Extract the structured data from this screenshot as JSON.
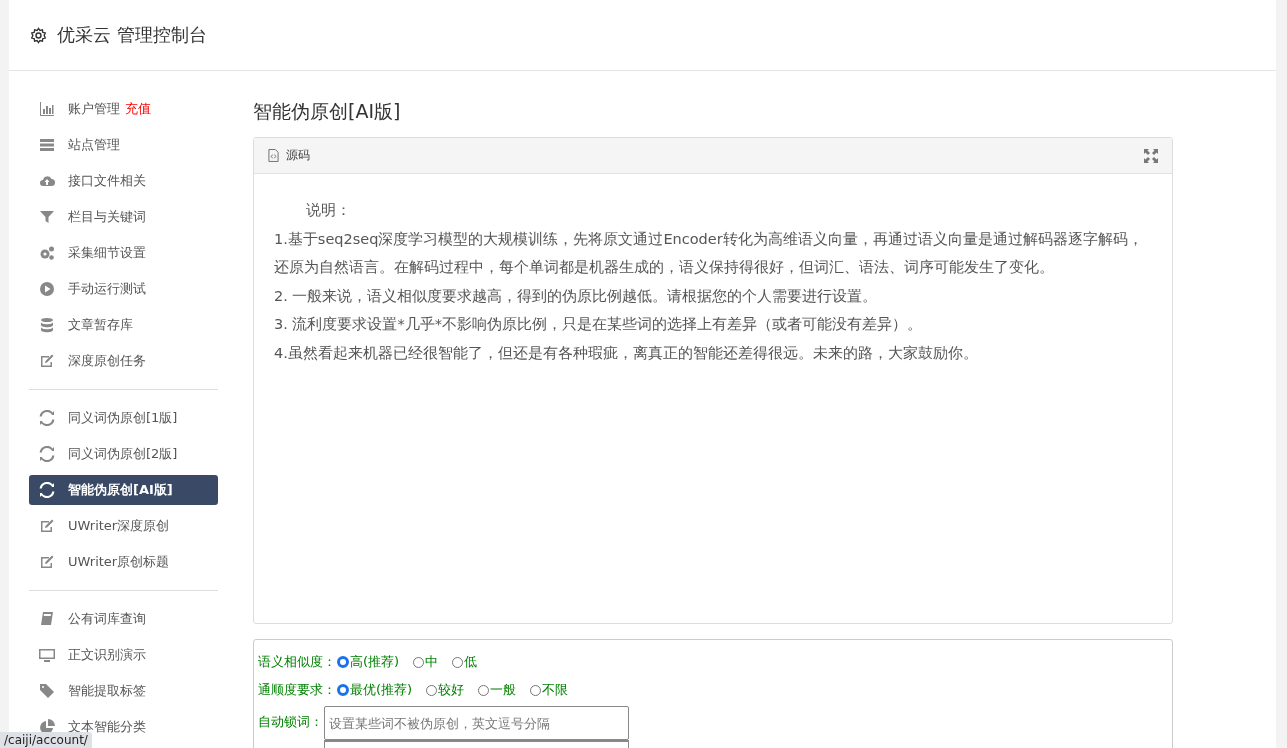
{
  "header": {
    "title": "优采云 管理控制台"
  },
  "sidebar": {
    "groups": [
      {
        "items": [
          {
            "label": "账户管理",
            "badge": "充值",
            "selected": false
          },
          {
            "label": "站点管理",
            "selected": false
          },
          {
            "label": "接口文件相关",
            "selected": false
          },
          {
            "label": "栏目与关键词",
            "selected": false
          },
          {
            "label": "采集细节设置",
            "selected": false
          },
          {
            "label": "手动运行测试",
            "selected": false
          },
          {
            "label": "文章暂存库",
            "selected": false
          },
          {
            "label": "深度原创任务",
            "selected": false
          }
        ]
      },
      {
        "items": [
          {
            "label": "同义词伪原创[1版]",
            "selected": false
          },
          {
            "label": "同义词伪原创[2版]",
            "selected": false
          },
          {
            "label": "智能伪原创[AI版]",
            "selected": true
          },
          {
            "label": "UWriter深度原创",
            "selected": false
          },
          {
            "label": "UWriter原创标题",
            "selected": false
          }
        ]
      },
      {
        "items": [
          {
            "label": "公有词库查询",
            "selected": false
          },
          {
            "label": "正文识别演示",
            "selected": false
          },
          {
            "label": "智能提取标签",
            "selected": false
          },
          {
            "label": "文本智能分类",
            "selected": false
          }
        ]
      }
    ]
  },
  "main": {
    "heading": "智能伪原创[AI版]",
    "source_panel": {
      "tab": "源码",
      "paragraphs": [
        {
          "kind": "title",
          "text": "说明："
        },
        {
          "kind": "body",
          "text": "1.基于seq2seq深度学习模型的大规模训练，先将原文通过Encoder转化为高维语义向量，再通过语义向量是通过解码器逐字解码，还原为自然语言。在解码过程中，每个单词都是机器生成的，语义保持得很好，但词汇、语法、词序可能发生了变化。"
        },
        {
          "kind": "body",
          "text": "2. 一般来说，语义相似度要求越高，得到的伪原比例越低。请根据您的个人需要进行设置。"
        },
        {
          "kind": "body",
          "text": "3. 流利度要求设置*几乎*不影响伪原比例，只是在某些词的选择上有差异（或者可能没有差异）。"
        },
        {
          "kind": "body",
          "text": "4.虽然看起来机器已经很智能了，但还是有各种瑕疵，离真正的智能还差得很远。未来的路，大家鼓励你。"
        }
      ]
    },
    "form": {
      "radio_rows": [
        {
          "label": "语义相似度：",
          "options": [
            {
              "label": "高(推荐)",
              "selected": true
            },
            {
              "label": "中",
              "selected": false
            },
            {
              "label": "低",
              "selected": false
            }
          ]
        },
        {
          "label": "通顺度要求：",
          "options": [
            {
              "label": "最优(推荐)",
              "selected": true
            },
            {
              "label": "较好",
              "selected": false
            },
            {
              "label": "一般",
              "selected": false
            },
            {
              "label": "不限",
              "selected": false
            }
          ]
        }
      ],
      "lock_words": {
        "label": "自动锁词：",
        "placeholder": "设置某些词不被伪原创，英文逗号分隔"
      }
    }
  },
  "status_url": "/caiji/account/"
}
